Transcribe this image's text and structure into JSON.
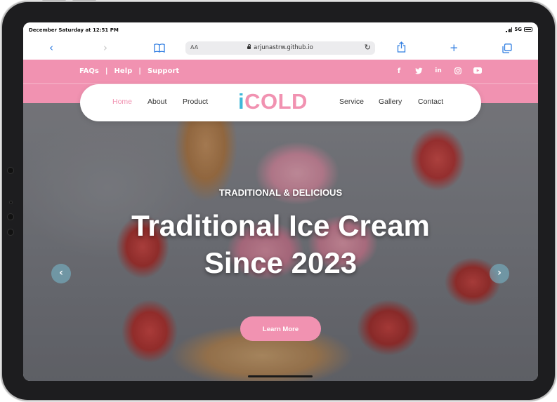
{
  "status_bar": {
    "time": "December Saturday at 12:51 PM",
    "network": "5G"
  },
  "browser": {
    "text_size_label": "AA",
    "url": "arjunastrw.github.io",
    "icons": [
      "back-icon",
      "forward-icon",
      "bookmarks-icon",
      "lock-icon",
      "reload-icon",
      "share-icon",
      "new-tab-icon",
      "tabs-icon"
    ],
    "accent_color": "#2f7de1"
  },
  "topbar": {
    "links": [
      "FAQs",
      "Help",
      "Support"
    ],
    "separator": "|",
    "social_icons": [
      "facebook-icon",
      "twitter-icon",
      "linkedin-icon",
      "instagram-icon",
      "youtube-icon"
    ],
    "social_glyphs": [
      "f",
      "t",
      "in",
      "◎",
      "▶"
    ],
    "background_color": "#f192b1"
  },
  "nav": {
    "left_items": [
      "Home",
      "About",
      "Product"
    ],
    "right_items": [
      "Service",
      "Gallery",
      "Contact"
    ],
    "active_item": "Home",
    "logo": {
      "prefix": "i",
      "main": "COLD"
    },
    "logo_colors": {
      "i": "#3fb7d9",
      "cold": "#f192b1"
    }
  },
  "hero": {
    "subtitle": "TRADITIONAL & DELICIOUS",
    "title_line1": "Traditional Ice Cream",
    "title_line2": "Since 2023",
    "button_label": "Learn More",
    "prev_arrow": "‹",
    "next_arrow": "›"
  }
}
